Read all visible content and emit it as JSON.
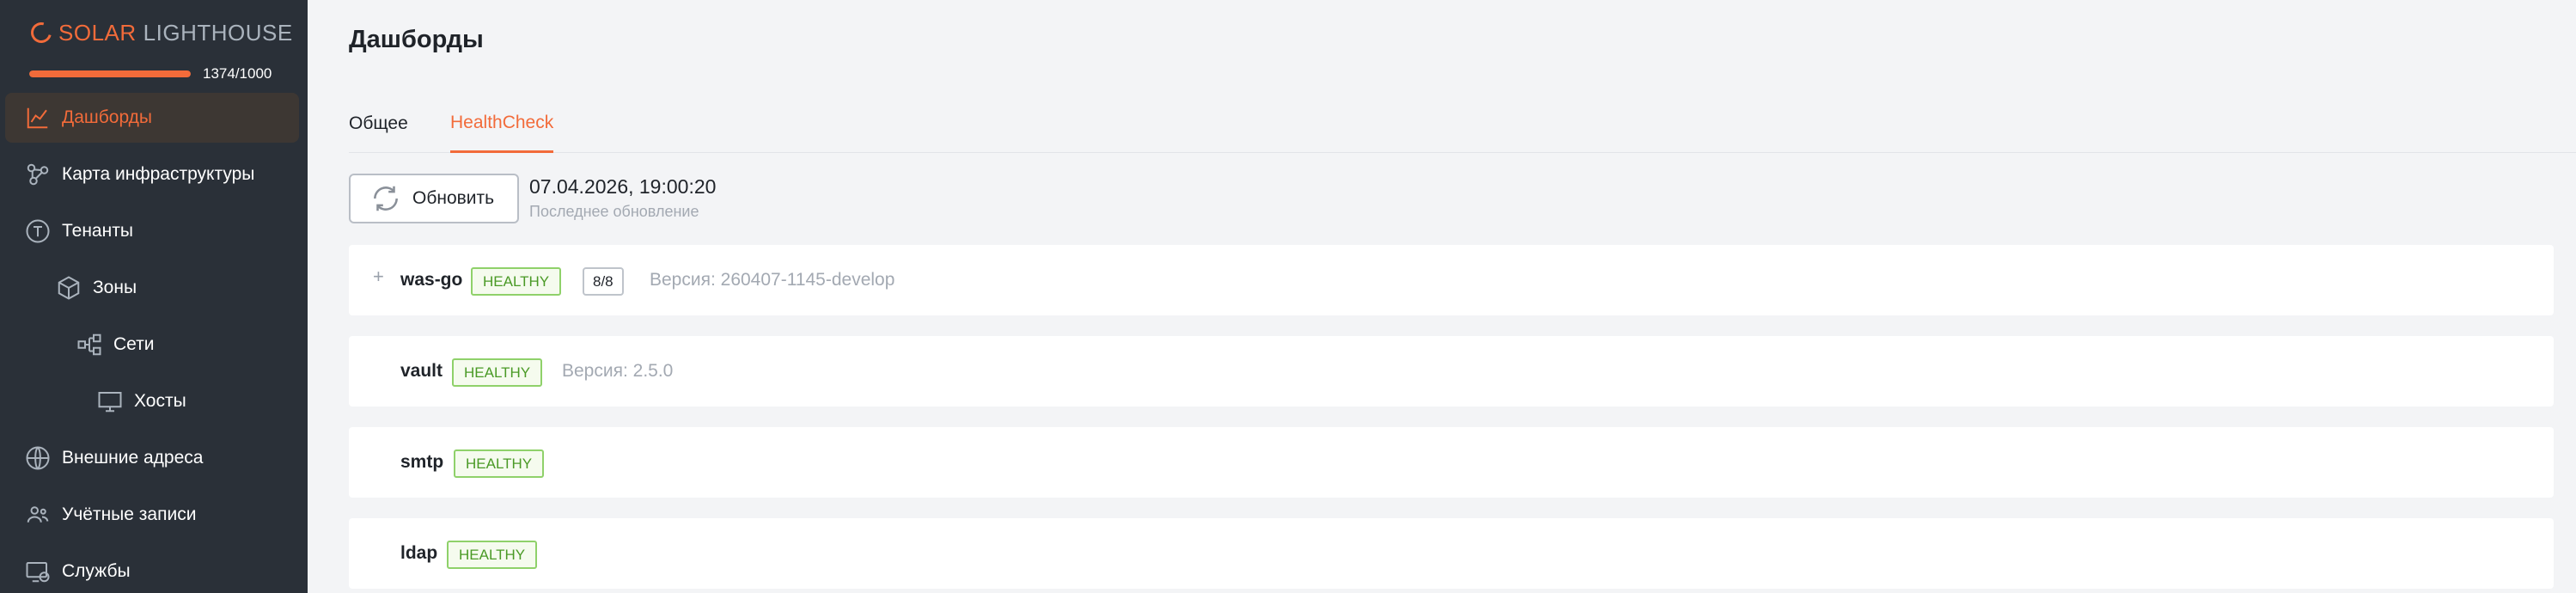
{
  "sidebar": {
    "logo": {
      "brand": "SOLAR",
      "product": "LIGHTHOUSE"
    },
    "quota": {
      "text": "1374/1000",
      "used": 1374,
      "limit": 1000,
      "fill_fraction": 1.0
    },
    "items": [
      {
        "label": "Дашборды",
        "icon": "chart-line-icon",
        "active": true
      },
      {
        "label": "Карта инфраструктуры",
        "icon": "graph-nodes-icon",
        "active": false
      },
      {
        "label": "Тенанты",
        "icon": "tenant-circle-icon",
        "active": false
      },
      {
        "label": "Зоны",
        "icon": "cube-icon",
        "active": false
      },
      {
        "label": "Сети",
        "icon": "network-icon",
        "active": false
      },
      {
        "label": "Хосты",
        "icon": "monitor-icon",
        "active": false
      },
      {
        "label": "Внешние адреса",
        "icon": "globe-icon",
        "active": false
      },
      {
        "label": "Учётные записи",
        "icon": "users-icon",
        "active": false
      },
      {
        "label": "Службы",
        "icon": "services-icon",
        "active": false
      }
    ]
  },
  "main": {
    "title": "Дашборды",
    "tabs": [
      {
        "label": "Общее",
        "active": false
      },
      {
        "label": "HealthCheck",
        "active": true
      }
    ],
    "refresh": {
      "button_label": "Обновить",
      "icon": "refresh-icon",
      "timestamp": "07.04.2026, 19:00:20",
      "caption": "Последнее обновление"
    },
    "services": [
      {
        "name": "was-go",
        "status": "HEALTHY",
        "count": "8/8",
        "version": "Версия: 260407-1145-develop",
        "expand": "+"
      },
      {
        "name": "vault",
        "status": "HEALTHY",
        "version": "Версия: 2.5.0"
      },
      {
        "name": "smtp",
        "status": "HEALTHY"
      },
      {
        "name": "ldap",
        "status": "HEALTHY"
      }
    ]
  },
  "colors": {
    "accent": "#f26b3a",
    "sidebar_bg": "#2a3038",
    "healthy_border": "#8fd16a",
    "healthy_text": "#4a9a26"
  }
}
